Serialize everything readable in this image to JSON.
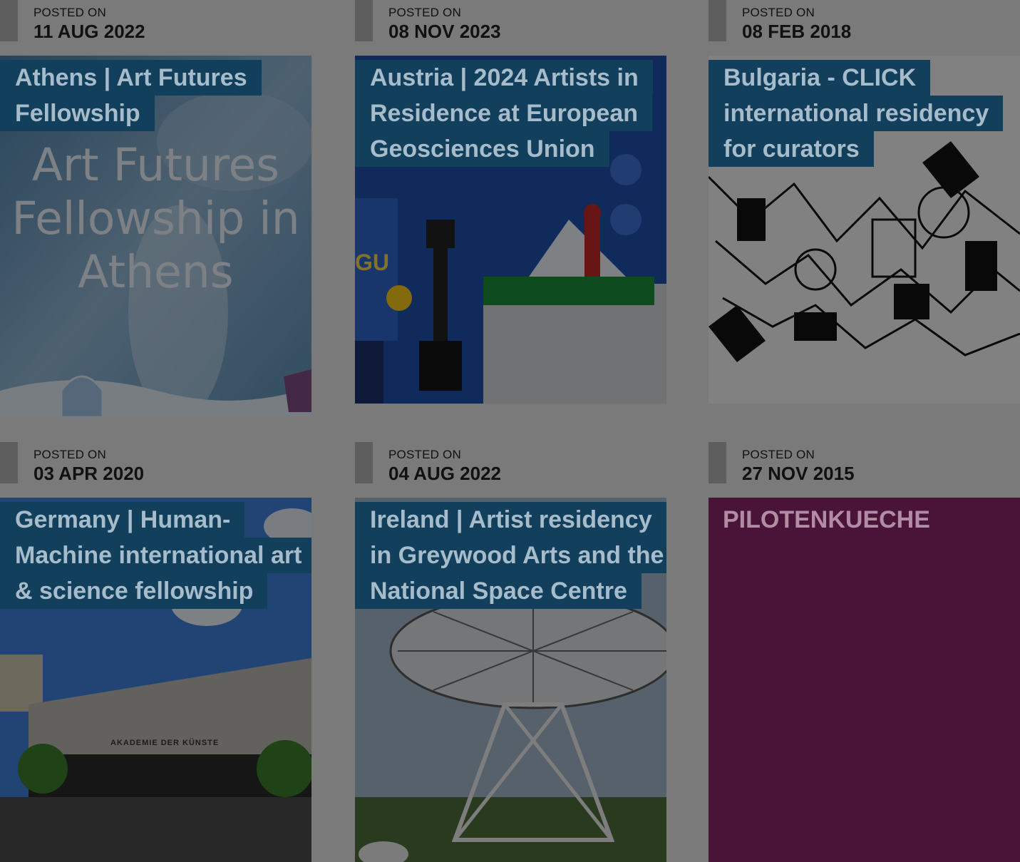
{
  "posted_label": "POSTED ON",
  "cards": [
    {
      "date": "11 AUG 2022",
      "title": "Athens | Art Futures Fellowship",
      "image_text": [
        "Art Futures",
        "Fellowship in",
        "Athens"
      ]
    },
    {
      "date": "08 NOV 2023",
      "title": "Austria | 2024 Artists in Residence at European Geosciences Union",
      "image_text": "GU"
    },
    {
      "date": "08 FEB 2018",
      "title": "Bulgaria - CLICK international residency for curators"
    },
    {
      "date": "03 APR 2020",
      "title": "Germany | Human-Machine international art & science fellowship",
      "image_text": "AKADEMIE DER KÜNSTE"
    },
    {
      "date": "04 AUG 2022",
      "title": "Ireland | Artist residency in Greywood Arts and the National Space Centre"
    },
    {
      "date": "27 NOV 2015",
      "title": "PILOTENKUECHE"
    }
  ],
  "colors": {
    "overlay_title_bg": "#123f5b",
    "pilotenkueche_bg": "#4a1438",
    "page_bg": "#7a7a7a"
  }
}
